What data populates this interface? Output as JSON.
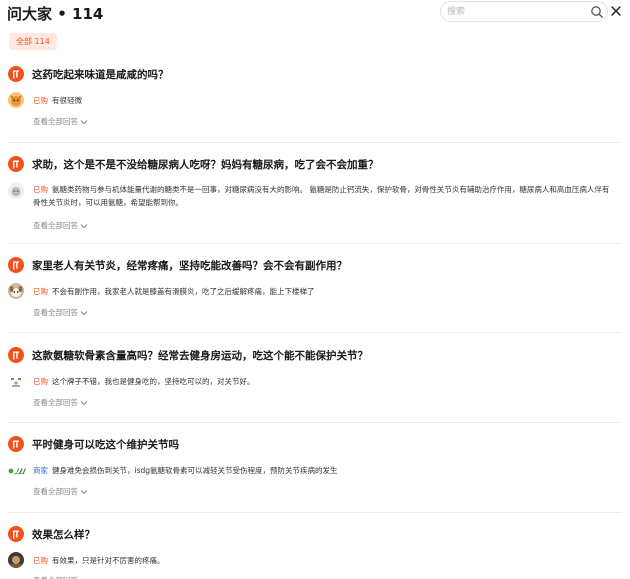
{
  "header": {
    "title": "问大家 • 114",
    "search_placeholder": "搜索"
  },
  "filter": {
    "label": "全部 114"
  },
  "view_all_label": "查看全部回答",
  "colors": {
    "accent": "#f3521c",
    "merchant": "#2a6fd6",
    "chip_bg": "#fde9e1"
  },
  "questions": [
    {
      "text": "这药吃起来味道是咸咸的吗？",
      "answer_tag": "已购",
      "answer": "有很轻微",
      "avatar_icon": "cartoon-fox-avatar"
    },
    {
      "text": "求助，这个是不是不没给糖尿病人吃呀？妈妈有糖尿病，吃了会不会加重？",
      "answer_tag": "已购",
      "answer": "氨糖类药物与参与机体能量代谢的糖类不是一回事，对糖尿病没有大的影响。 氨糖是防止钙流失，保护软骨，对骨性关节炎有辅助治疗作用，糖尿病人和高血压病人伴有骨性关节炎时，可以用氨糖，希望能帮到你。",
      "avatar_icon": "gray-cartoon-avatar"
    },
    {
      "text": "家里老人有关节炎，经常疼痛，坚持吃能改善吗？会不会有副作用？",
      "answer_tag": "已购",
      "answer": "不会有副作用，我家老人就是膝盖有滑膜炎，吃了之后缓解疼痛，能上下楼梯了",
      "avatar_icon": "puppy-avatar"
    },
    {
      "text": "这款氨糖软骨素含量高吗？经常去健身房运动，吃这个能不能保护关节？",
      "answer_tag": "已购",
      "answer": "这个牌子不错，我也是健身吃的，坚持吃可以的，对关节好。",
      "avatar_icon": "smiley-avatar"
    },
    {
      "text": "平时健身可以吃这个维护关节吗",
      "answer_tag": "商家",
      "answer": "健身难免会损伤到关节，isdg氨糖软骨素可以减轻关节受伤程度，预防关节疾病的发生",
      "avatar_icon": "brand-logo-avatar",
      "merchant": true
    },
    {
      "text": "效果怎么样？",
      "answer_tag": "已购",
      "answer": "有效果，只是针对不厉害的疼痛。",
      "avatar_icon": "photo-avatar"
    }
  ]
}
